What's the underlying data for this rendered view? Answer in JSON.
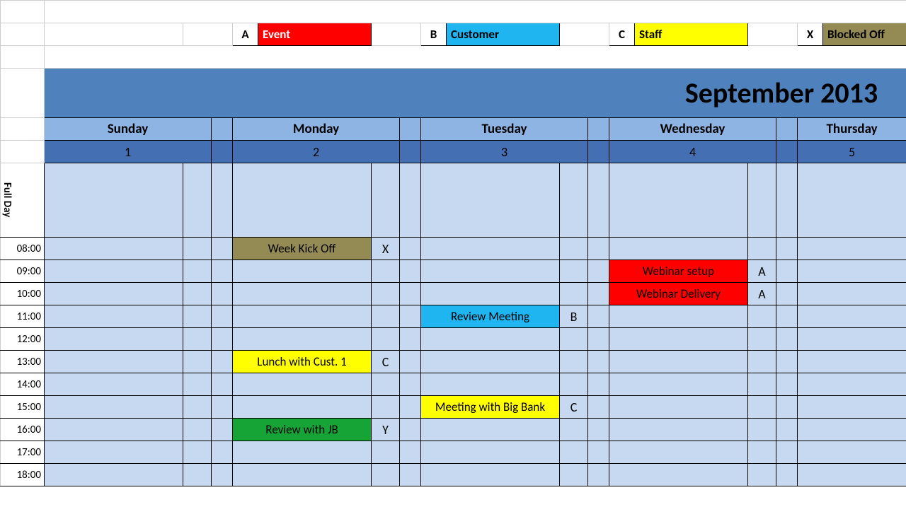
{
  "legend": {
    "event": {
      "letter": "A",
      "label": "Event"
    },
    "customer": {
      "letter": "B",
      "label": "Customer"
    },
    "staff": {
      "letter": "C",
      "label": "Staff"
    },
    "blocked": {
      "letter": "X",
      "label": "Blocked Off"
    }
  },
  "title": "September 2013",
  "days": {
    "sun": "Sunday",
    "mon": "Monday",
    "tue": "Tuesday",
    "wed": "Wednesday",
    "thu": "Thursday"
  },
  "dates": {
    "sun": "1",
    "mon": "2",
    "tue": "3",
    "wed": "4",
    "thu": "5"
  },
  "rows": {
    "fullday": "Full Day",
    "h08": "08:00",
    "h09": "09:00",
    "h10": "10:00",
    "h11": "11:00",
    "h12": "12:00",
    "h13": "13:00",
    "h14": "14:00",
    "h15": "15:00",
    "h16": "16:00",
    "h17": "17:00",
    "h18": "18:00"
  },
  "events": {
    "kickoff": {
      "text": "Week Kick Off",
      "code": "X"
    },
    "lunch": {
      "text": "Lunch with Cust. 1",
      "code": "C"
    },
    "reviewjb": {
      "text": "Review with JB",
      "code": "Y"
    },
    "reviewmtg": {
      "text": "Review Meeting",
      "code": "B"
    },
    "bigbank": {
      "text": "Meeting with Big Bank",
      "code": "C"
    },
    "websetup": {
      "text": "Webinar setup",
      "code": "A"
    },
    "webdeliv": {
      "text": "Webinar Delivery",
      "code": "A"
    }
  }
}
